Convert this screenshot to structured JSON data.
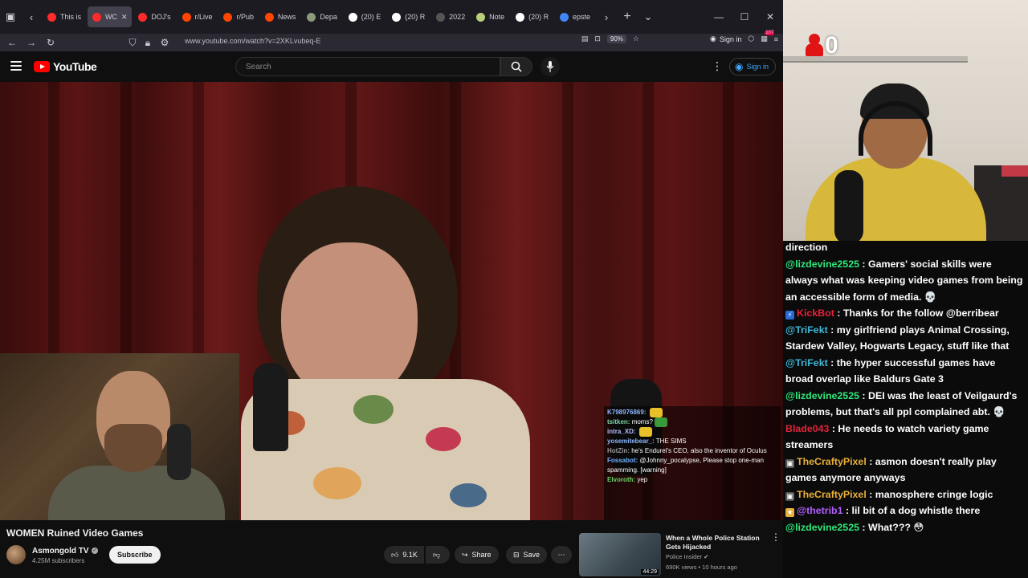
{
  "browser": {
    "tabs": [
      {
        "label": "This is",
        "color": "#ff2a2a",
        "active": false
      },
      {
        "label": "WC",
        "color": "#ff2a2a",
        "active": true
      },
      {
        "label": "DOJ's",
        "color": "#ff2a2a",
        "active": false
      },
      {
        "label": "r/Live",
        "color": "#ff4500",
        "active": false
      },
      {
        "label": "r/Pub",
        "color": "#ff4500",
        "active": false
      },
      {
        "label": "News",
        "color": "#ff4500",
        "active": false
      },
      {
        "label": "Depa",
        "color": "#8b9a7a",
        "active": false
      },
      {
        "label": "(20) E",
        "color": "#ffffff",
        "active": false
      },
      {
        "label": "(20) R",
        "color": "#ffffff",
        "active": false
      },
      {
        "label": "2022",
        "color": "#555555",
        "active": false
      },
      {
        "label": "Note",
        "color": "#b9d07a",
        "active": false
      },
      {
        "label": "(20) R",
        "color": "#ffffff",
        "active": false
      },
      {
        "label": "epste",
        "color": "#4285f4",
        "active": false
      }
    ],
    "url": "www.youtube.com/watch?v=2XKLvubeq-E",
    "zoom": "90%",
    "sign_in": "Sign in",
    "notif_count": "107"
  },
  "youtube": {
    "logo_text": "YouTube",
    "search_placeholder": "Search",
    "sign_in": "Sign in"
  },
  "video": {
    "title": "WOMEN Ruined Video Games",
    "channel": "Asmongold TV",
    "subscribers": "4.25M subscribers",
    "subscribe_label": "Subscribe",
    "likes": "9.1K",
    "share_label": "Share",
    "save_label": "Save"
  },
  "overlay_chat": [
    {
      "user": "K798976869:",
      "text": "",
      "color": "#8fb6ff"
    },
    {
      "user": "tsitken:",
      "text": "moms?",
      "color": "#7fd3a4"
    },
    {
      "user": "intra_XD:",
      "text": "",
      "color": "#b9b9ff"
    },
    {
      "user": "yosemitebear_:",
      "text": "THE SIMS",
      "color": "#8fb6ff"
    },
    {
      "user": "HotZin:",
      "text": "he's Endurel's CEO, also the inventor of Oculus",
      "color": "#9a9a9a"
    },
    {
      "user": "Fossabot:",
      "text": "@Johnny_pocalypse, Please stop one-man spamming. [warning]",
      "color": "#6fb0ff"
    },
    {
      "user": "Elvoroth:",
      "text": "yep",
      "color": "#6ad46a"
    }
  ],
  "recommended": {
    "title": "When a Whole Police Station Gets Hijacked",
    "channel": "Police Insider",
    "meta": "690K views • 10 hours ago",
    "duration": "44:29"
  },
  "stream": {
    "counter": "0"
  },
  "chat": [
    {
      "user": "",
      "text": "direction",
      "color": "#ffffff",
      "badge": ""
    },
    {
      "user": "@lizdevine2525",
      "text": " : Gamers' social skills were always what was keeping video games from being an accessible form of media. 💀",
      "color": "#2ee87a",
      "badge": ""
    },
    {
      "user": "KickBot",
      "text": " : Thanks for the follow @berribear",
      "color": "#e8213a",
      "badge": "bot"
    },
    {
      "user": "@TriFekt",
      "text": " : my girlfriend plays Animal Crossing, Stardew Valley, Hogwarts Legacy, stuff like that",
      "color": "#3fb8d8",
      "badge": ""
    },
    {
      "user": "@TriFekt",
      "text": " : the hyper successful games have broad overlap like Baldurs Gate 3",
      "color": "#3fb8d8",
      "badge": ""
    },
    {
      "user": "@lizdevine2525",
      "text": " : DEI was the least of Veilgaurd's problems, but that's all ppl complained abt. 💀",
      "color": "#2ee87a",
      "badge": ""
    },
    {
      "user": "Blade043",
      "text": " : He needs to watch variety game streamers",
      "color": "#e0243a",
      "badge": ""
    },
    {
      "user": "TheCraftyPixel",
      "text": " : asmon doesn't really play games anymore anyways",
      "color": "#e8b03a",
      "badge": "mod"
    },
    {
      "user": "TheCraftyPixel",
      "text": " : manosphere cringe logic",
      "color": "#e8b03a",
      "badge": "mod"
    },
    {
      "user": "@thetrib1",
      "text": " : lil bit of a dog whistle there",
      "color": "#b260ff",
      "badge": "star"
    },
    {
      "user": "@lizdevine2525",
      "text": " : What??? 😳",
      "color": "#2ee87a",
      "badge": ""
    }
  ]
}
